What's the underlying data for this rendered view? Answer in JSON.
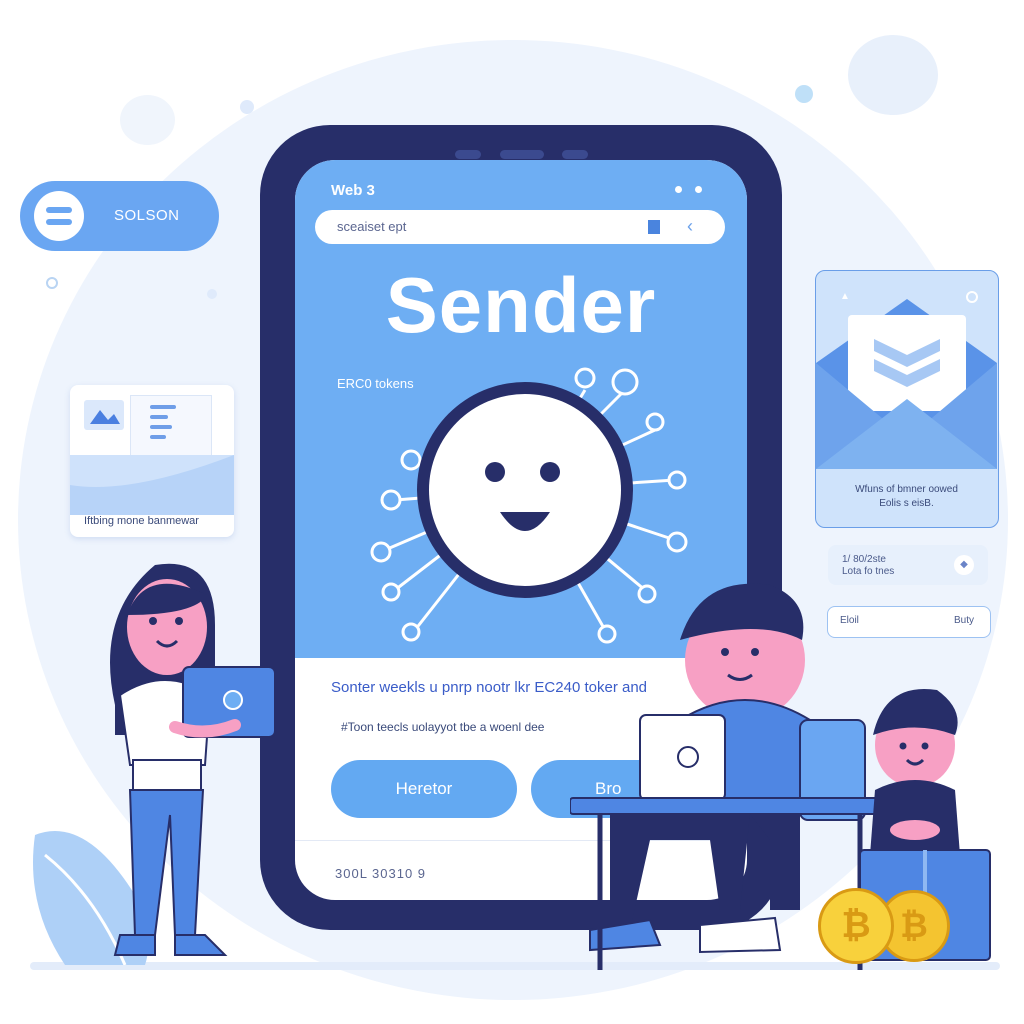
{
  "pill": {
    "label": "SOLSON"
  },
  "doc_card": {
    "caption": "Iftbing mone banmewar"
  },
  "phone": {
    "header": "Web 3",
    "url": "sceaiset ept",
    "title": "Sender",
    "subtitle": "ERC0 tokens",
    "description": "Sonter weekls u pnrp nootr lkr EC240 toker and",
    "note": "#Toon teecls uolayyot tbe a woenl dee",
    "button_primary": "Heretor",
    "button_secondary": "Bro",
    "footer": "300L 30310 9"
  },
  "envelope_card": {
    "caption_line1": "Wfuns of bmner oowed",
    "caption_line2": "Eolis s eisB."
  },
  "panel_1": {
    "line1": "1/ 80/2ste",
    "line2": "Lota fo tnes"
  },
  "panel_2": {
    "left": "Eloil",
    "right": "Buty"
  },
  "coins": {
    "symbol": "₿"
  },
  "colors": {
    "primary_blue": "#6eaef3",
    "phone_frame": "#272e69",
    "coin_gold": "#f4c430"
  }
}
